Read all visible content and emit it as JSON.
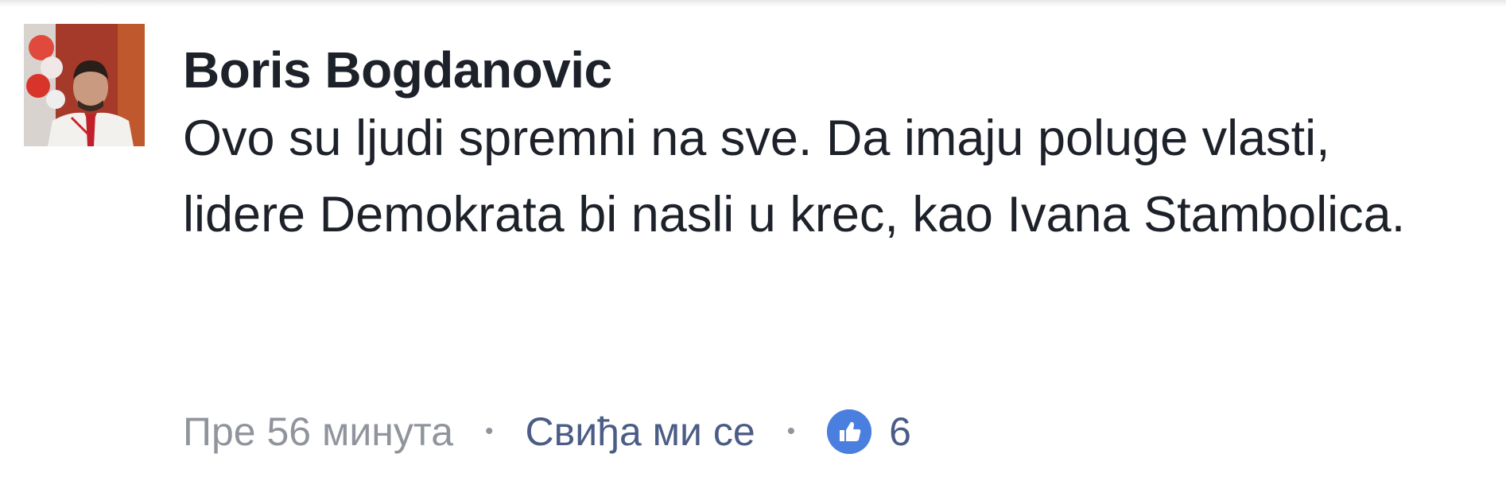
{
  "comment": {
    "author": "Boris Bogdanovic",
    "text": "Ovo su ljudi spremni na sve. Da imaju poluge vlasti, lidere Demokrata bi nasli u krec, kao Ivana Stambolica.",
    "timestamp": "Пре 56 минута",
    "like_label": "Свиђа ми се",
    "separator": "•",
    "reaction_count": "6",
    "reaction_icon": "thumbs-up-icon",
    "colors": {
      "author": "#1d2129",
      "meta": "#90949c",
      "link": "#4b5d86",
      "like_badge": "#4a7fe0"
    }
  }
}
